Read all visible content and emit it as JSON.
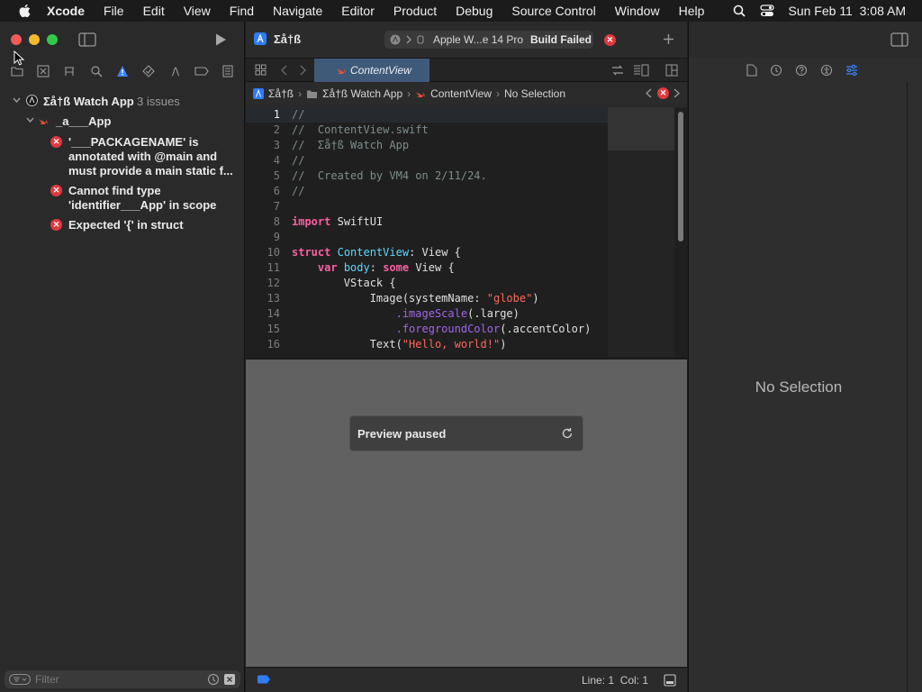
{
  "menubar": {
    "items": [
      "Xcode",
      "File",
      "Edit",
      "View",
      "Find",
      "Navigate",
      "Editor",
      "Product",
      "Debug",
      "Source Control",
      "Window",
      "Help"
    ],
    "datetime": "Sun Feb 11  3:08 AM"
  },
  "navigator": {
    "project": {
      "name": "Σå†ß Watch App",
      "issues": "3 issues"
    },
    "file": "_a___App",
    "errors": [
      {
        "lines": [
          "'___PACKAGENAME' is",
          "annotated with @main and",
          "must provide a main static f..."
        ]
      },
      {
        "lines": [
          "Cannot find type",
          "'identifier___App' in scope"
        ]
      },
      {
        "lines": [
          "Expected '{' in struct"
        ]
      }
    ],
    "filter_placeholder": "Filter"
  },
  "toolbar": {
    "scheme": "Σå†ß",
    "destination": "Apple W...e 14 Pro",
    "status": "Build Failed"
  },
  "tab": {
    "label": "ContentView"
  },
  "jumpbar": {
    "project": "Σå†ß",
    "group": "Σå†ß Watch App",
    "file": "ContentView",
    "selection": "No Selection"
  },
  "code": {
    "line_numbers": [
      "1",
      "2",
      "3",
      "4",
      "5",
      "6",
      "7",
      "8",
      "9",
      "10",
      "11",
      "12",
      "13",
      "14",
      "15",
      "16"
    ],
    "l1": "//",
    "l2": "//  ContentView.swift",
    "l3": "//  Σå†ß Watch App",
    "l4": "//",
    "l5": "//  Created by VM4 on 2/11/24.",
    "l6": "//",
    "import_kw": "import",
    "import_mod": "SwiftUI",
    "struct_kw": "struct",
    "struct_name": "ContentView",
    "struct_rest": ": View {",
    "var_kw": "var",
    "body_name": "body",
    "some_kw": "some",
    "view_type": "View {",
    "vstack": "VStack {",
    "image_call": "Image(systemName: ",
    "globe": "\"globe\"",
    "close_paren": ")",
    "imagescale": ".imageScale",
    "large": "(.large)",
    "fgcolor": ".foregroundColor",
    "accent": "(.accentColor)",
    "text_call": "Text(",
    "hello": "\"Hello, world!\""
  },
  "preview": {
    "message": "Preview paused"
  },
  "status": {
    "position": "Line: 1  Col: 1"
  },
  "inspector": {
    "empty": "No Selection"
  }
}
